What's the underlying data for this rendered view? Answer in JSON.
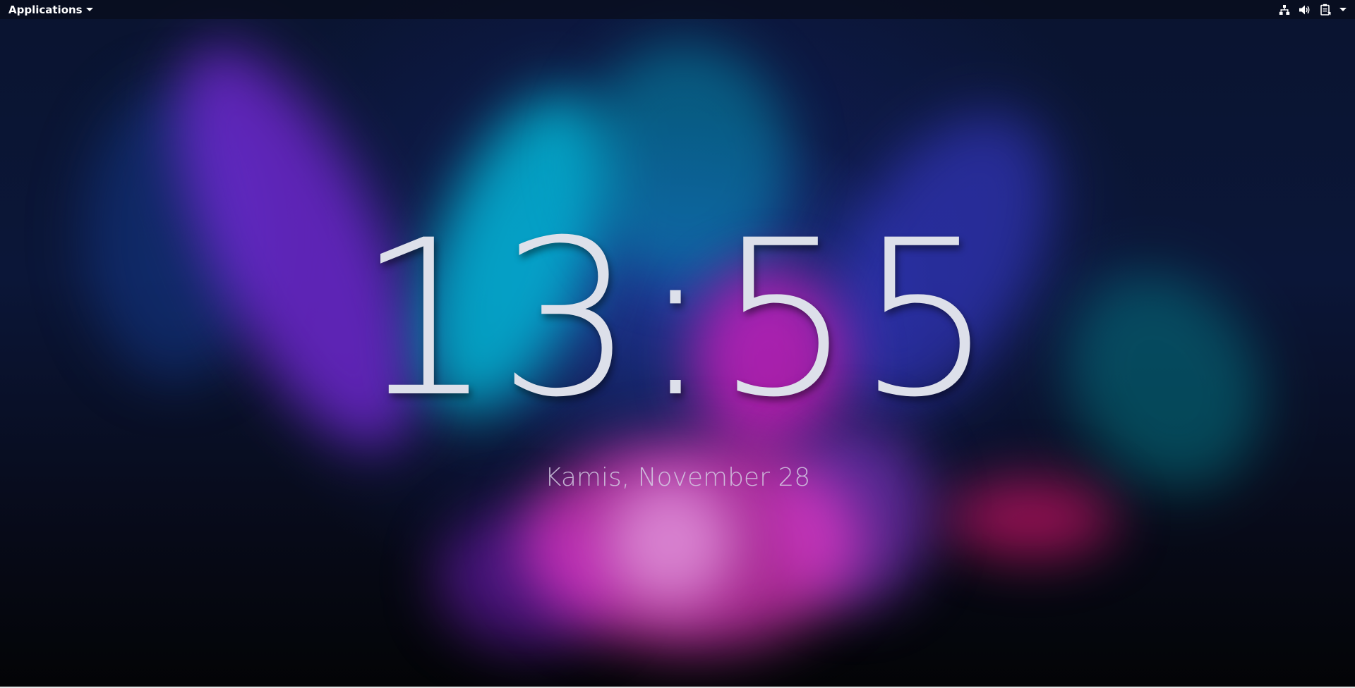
{
  "topbar": {
    "applications_label": "Applications",
    "tray_icons": [
      "network-icon",
      "volume-icon",
      "clipboard-icon",
      "chevron-down-icon"
    ]
  },
  "lockscreen": {
    "time": "13:55",
    "date": "Kamis, November 28"
  },
  "colors": {
    "clock_text": "#dde0ea",
    "panel_bg": "#080c1a",
    "accent_pink": "#ff3cd2",
    "accent_cyan": "#00c8e6",
    "accent_purple": "#7828dc"
  }
}
